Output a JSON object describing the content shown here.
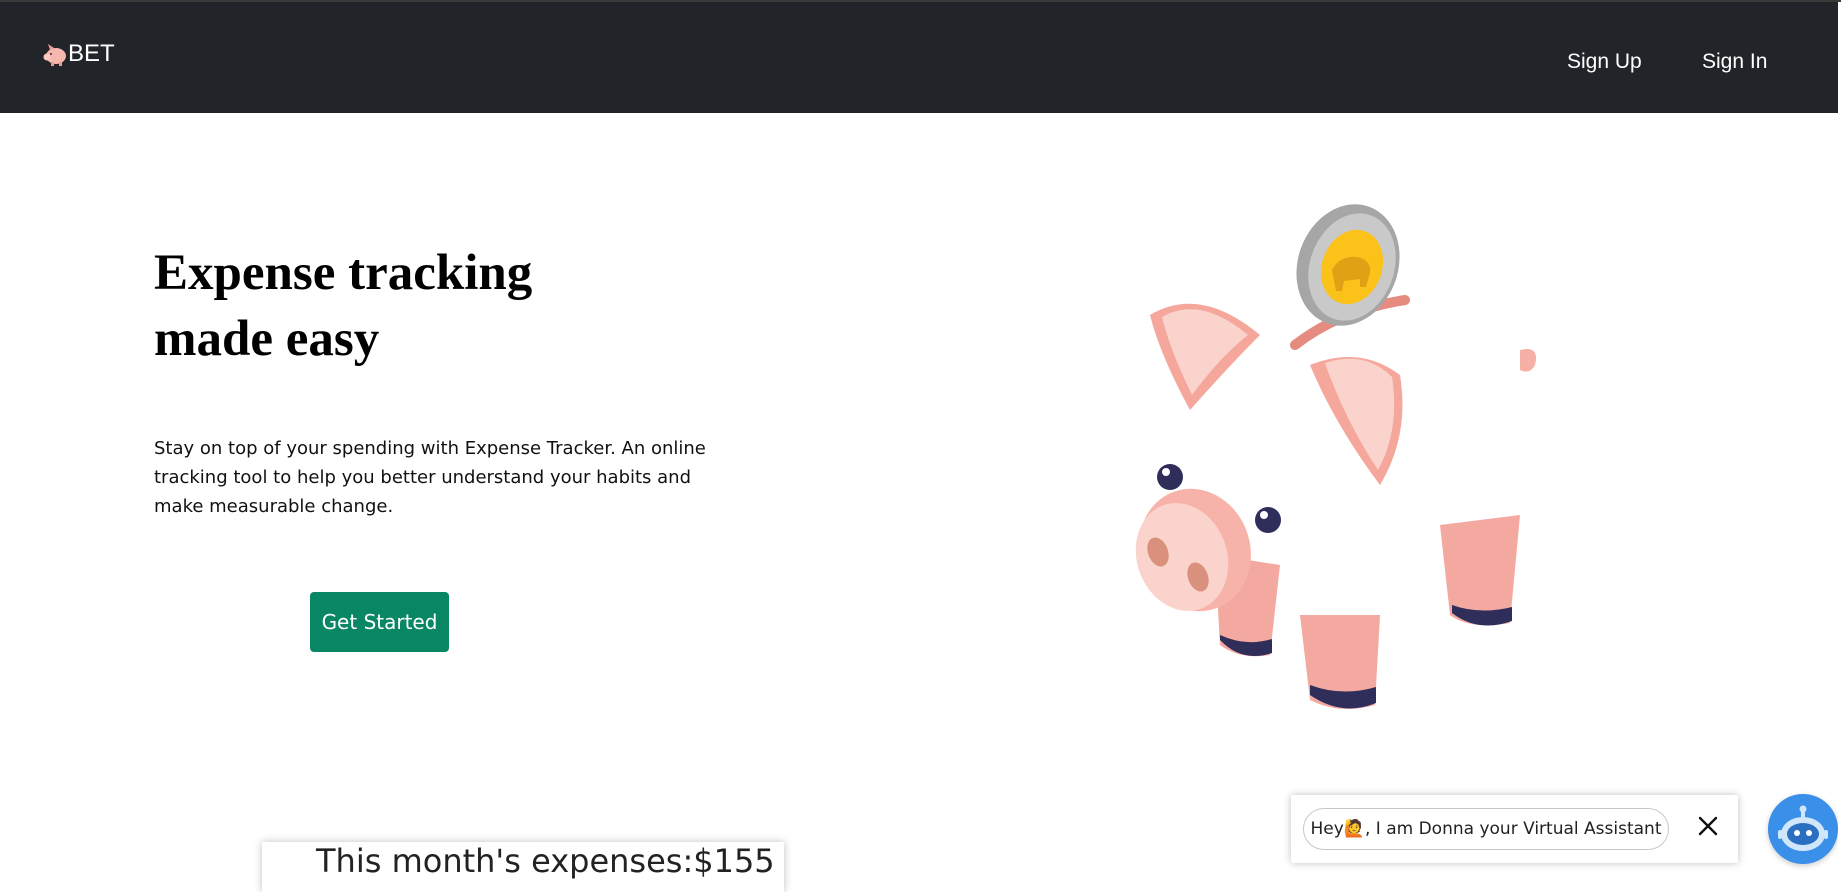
{
  "nav": {
    "brand": "BET",
    "links": [
      "Sign Up",
      "Sign In"
    ]
  },
  "hero": {
    "title_line1": "Expense tracking",
    "title_line2": "made easy",
    "description": "Stay on top of your spending with Expense Tracker. An online tracking tool to help you better understand your habits and make measurable change.",
    "cta": "Get Started"
  },
  "expenses": {
    "label": "This month's expenses:$155"
  },
  "assistant": {
    "greeting_prefix": "Hey ",
    "greeting_suffix": ", I am Donna your Virtual Assistant",
    "wave_emoji": "🙋"
  },
  "icons": {
    "brand": "piggy-bank-icon",
    "close": "close-icon",
    "bot": "robot-icon"
  },
  "colors": {
    "navbar": "#212529",
    "cta": "#098765",
    "bot": "#3a8fe8"
  }
}
